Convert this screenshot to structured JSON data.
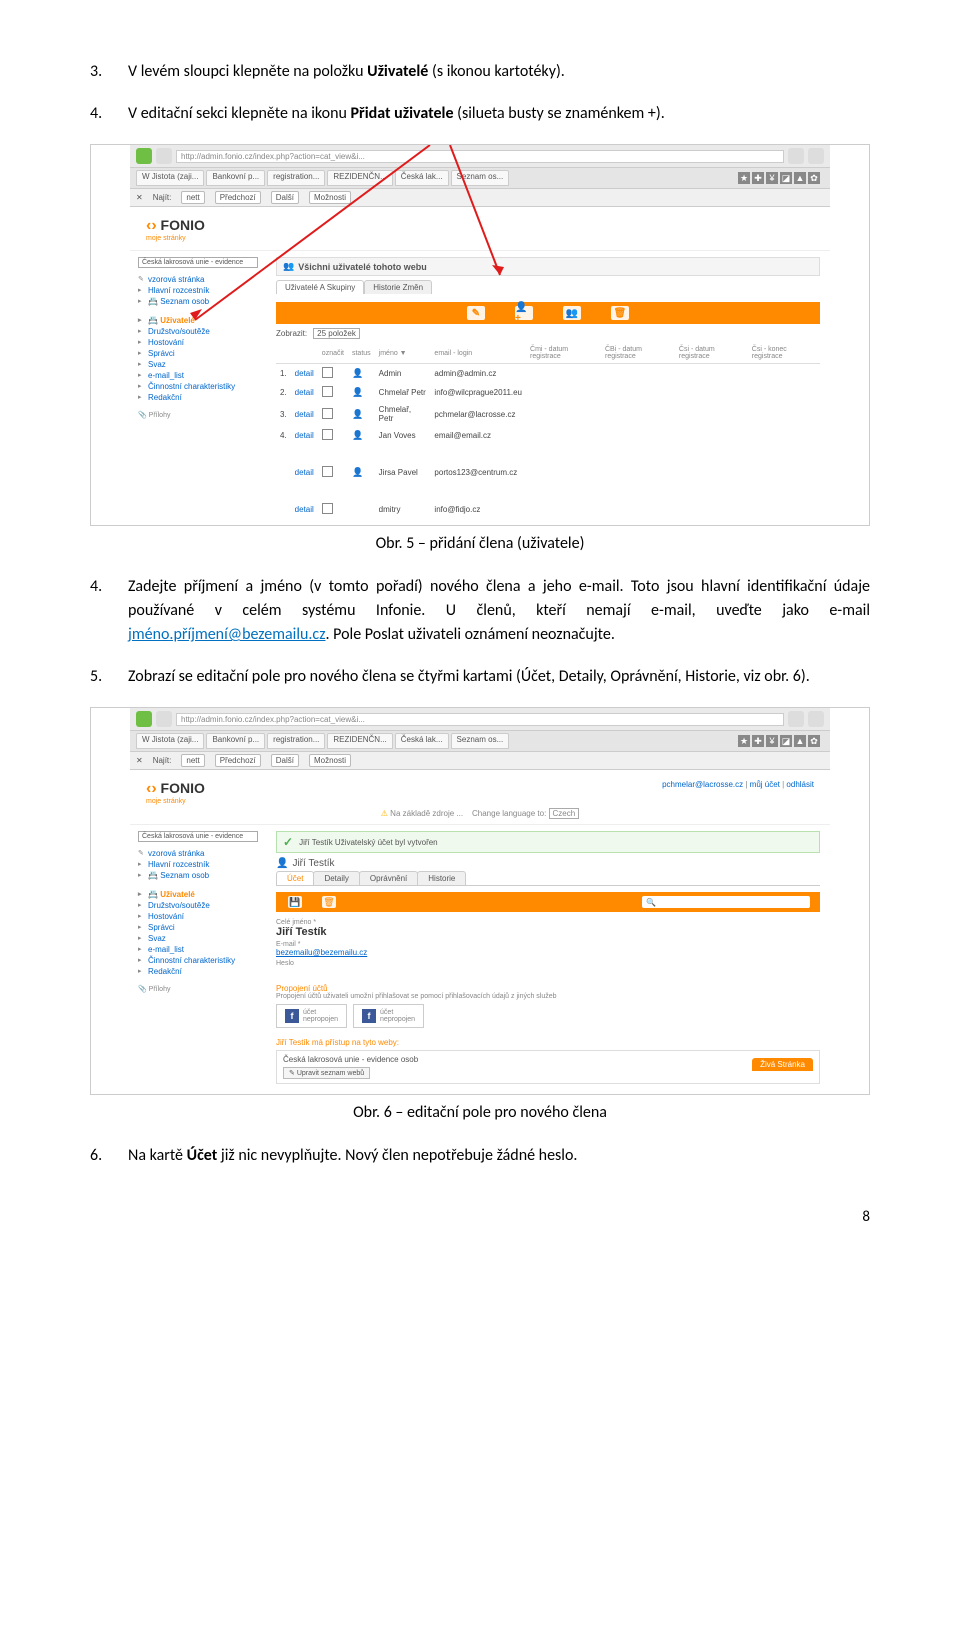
{
  "page_number": "8",
  "steps": {
    "s3": {
      "num": "3.",
      "pre": "V levém sloupci klepněte na položku ",
      "bold": "Uživatelé",
      "post": " (s ikonou kartotéky)."
    },
    "s4": {
      "num": "4.",
      "pre": "V editační sekci klepněte na ikonu ",
      "bold": "Přidat uživatele",
      "post": " (silueta busty se znaménkem +)."
    },
    "s4b": {
      "num": "4.",
      "a": "Zadejte příjmení a jméno (v tomto pořadí) nového člena a jeho e-mail. Toto jsou hlavní identifikační údaje používané v celém systému Infonie. U členů, kteří nemají e-mail, uveďte jako e-mail ",
      "link": "jméno.příjmení@bezemailu.cz",
      "b": ". Pole Poslat uživateli oznámení neoznačujte."
    },
    "s5": {
      "num": "5.",
      "text": "Zobrazí se editační pole pro nového člena se čtyřmi kartami (Účet, Detaily, Oprávnění, Historie, viz obr. 6)."
    },
    "s6": {
      "num": "6.",
      "pre": "Na kartě ",
      "bold": "Účet",
      "post": " již nic nevyplňujte. Nový člen nepotřebuje žádné heslo."
    }
  },
  "captions": {
    "c5": "Obr. 5 – přidání člena (uživatele)",
    "c6": "Obr. 6 – editační pole pro nového člena"
  },
  "shot1": {
    "url": "http://admin.fonio.cz/index.php?action=cat_view&i...",
    "tabs": [
      "W Jistota (zaji...",
      "Bankovní p...",
      "registration...",
      "REZIDENČN...",
      "Česká lak...",
      "Seznam os..."
    ],
    "find_label": "Najít:",
    "find_value": "nett",
    "find_prev": "Předchozí",
    "find_next": "Další",
    "find_opts": "Možnosti",
    "logo": "FONIO",
    "logo_sub": "moje stránky",
    "project": "Česká lakrosová unie - evidence",
    "sidebar_top": [
      "vzorová stránka",
      "Hlavní rozcestník",
      "Seznam osob"
    ],
    "sidebar_active": "Uživatelé",
    "sidebar_items": [
      "Družstvo/soutěže",
      "Hostování",
      "Správci",
      "Svaz",
      "e-mail_list",
      "Činnostní charakteristiky",
      "Redakční"
    ],
    "attachments": "Přílohy",
    "panel_title": "Všichni uživatelé tohoto webu",
    "inner_tabs": [
      "Uživatelé A Skupiny",
      "Historie Změn"
    ],
    "show_label": "Zobrazit:",
    "show_value": "25 položek",
    "columns": [
      "označit",
      "status",
      "jméno ▼",
      "email - login",
      "Čmi - datum registrace",
      "ČBi - datum registrace",
      "Čsi - datum registrace",
      "Čsi - konec registrace"
    ],
    "rows": [
      {
        "n": "1.",
        "name": "Admin",
        "email": "admin@admin.cz"
      },
      {
        "n": "2.",
        "name": "Chmelař Petr",
        "email": "info@wilcprague2011.eu"
      },
      {
        "n": "3.",
        "name": "Chmelař, Petr",
        "email": "pchmelar@lacrosse.cz"
      },
      {
        "n": "4.",
        "name": "Jan Voves",
        "email": "email@email.cz"
      }
    ],
    "gap_row": {
      "name": "Jirsa Pavel",
      "email": "portos123@centrum.cz"
    },
    "bottom_row": {
      "name": "dmitry",
      "email": "info@fidjo.cz"
    },
    "detail": "detail"
  },
  "shot2": {
    "url": "http://admin.fonio.cz/index.php?action=cat_view&i...",
    "tabs": [
      "W Jistota (zaji...",
      "Bankovní p...",
      "registration...",
      "REZIDENČN...",
      "Česká lak...",
      "Seznam os..."
    ],
    "find_label": "Najít:",
    "find_value": "nett",
    "find_prev": "Předchozí",
    "find_next": "Další",
    "find_opts": "Možnosti",
    "logo": "FONIO",
    "logo_sub": "moje stránky",
    "userline_a": "pchmelar@lacrosse.cz",
    "userline_b": "můj účet",
    "userline_c": "odhlásit",
    "lang_warn": "Na základě zdroje ...",
    "lang_label": "Change language to:",
    "lang_value": "Czech",
    "project": "Česká lakrosová unie - evidence",
    "sidebar_top": [
      "vzorová stránka",
      "Hlavní rozcestník",
      "Seznam osob"
    ],
    "sidebar_active": "Uživatelé",
    "sidebar_items": [
      "Družstvo/soutěže",
      "Hostování",
      "Správci",
      "Svaz",
      "e-mail_list",
      "Činnostní charakteristiky",
      "Redakční"
    ],
    "attachments": "Přílohy",
    "success": "Jiří Testík Uživatelský účet byl vytvořen",
    "user_name": "Jiří Testík",
    "inner_tabs": [
      "Účet",
      "Detaily",
      "Oprávnění",
      "Historie"
    ],
    "search_placeholder": "Q",
    "form": {
      "name_lbl": "Celé jméno *",
      "name_val": "Jiří Testík",
      "email_lbl": "E-mail *",
      "email_val": "bezemailu@bezemailu.cz",
      "pass_lbl": "Heslo"
    },
    "prop_head": "Propojení účtů",
    "prop_sub": "Propojení účtů uživateli umožní přihlašovat se pomocí přihlašovacích údajů z jiných služeb",
    "soc_label": "účet",
    "soc_status": "nepropojen",
    "access_head": "Jiří Testík má přístup na tyto weby:",
    "access_item": "Česká lakrosová unie - evidence osob",
    "access_btn": "Upravit seznam webů",
    "orange_badge": "Živá Stránka"
  }
}
